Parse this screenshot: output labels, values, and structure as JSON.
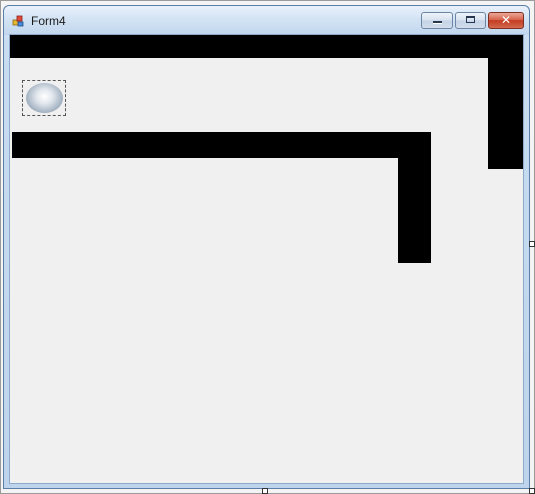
{
  "window": {
    "title": "Form4",
    "buttons": {
      "minimize": "minimize",
      "maximize": "maximize",
      "close": "✕"
    }
  },
  "colors": {
    "wall": "#000000",
    "client_background": "#f0f0f0",
    "close_button": "#c33b21"
  },
  "icons": {
    "app": "form-app-icon",
    "ball": "round-button-icon"
  }
}
